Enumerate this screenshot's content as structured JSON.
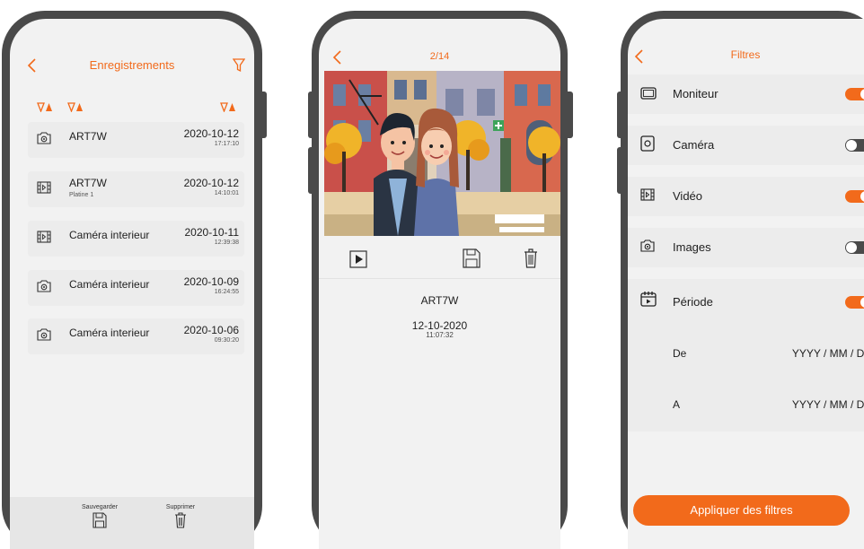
{
  "colors": {
    "accent": "#f26a1b",
    "frame": "#4a4a4a",
    "screen": "#f2f2f2"
  },
  "recordings": {
    "title": "Enregistrements",
    "items": [
      {
        "type": "camera-icon",
        "name": "ART7W",
        "sub": "",
        "date": "2020-10-12",
        "time": "17:17:10"
      },
      {
        "type": "video-icon",
        "name": "ART7W",
        "sub": "Platine 1",
        "date": "2020-10-12",
        "time": "14:10:01"
      },
      {
        "type": "video-icon",
        "name": "Caméra interieur",
        "sub": "",
        "date": "2020-10-11",
        "time": "12:39:38"
      },
      {
        "type": "camera-icon",
        "name": "Caméra interieur",
        "sub": "",
        "date": "2020-10-09",
        "time": "16:24:55"
      },
      {
        "type": "camera-icon",
        "name": "Caméra interieur",
        "sub": "",
        "date": "2020-10-06",
        "time": "09:30:20"
      }
    ],
    "save_label": "Sauvegarder",
    "delete_label": "Supprimer"
  },
  "viewer": {
    "counter": "2/14",
    "name": "ART7W",
    "date": "12-10-2020",
    "time": "11:07:32"
  },
  "filters": {
    "title": "Filtres",
    "options": [
      {
        "label": "Moniteur",
        "icon": "monitor-icon",
        "enabled": true
      },
      {
        "label": "Caméra",
        "icon": "camera-icon",
        "enabled": false
      },
      {
        "label": "Vidéo",
        "icon": "video-icon",
        "enabled": true
      },
      {
        "label": "Images",
        "icon": "image-icon",
        "enabled": false
      },
      {
        "label": "Période",
        "icon": "calendar-icon",
        "enabled": true
      }
    ],
    "from_label": "De",
    "from_value": "YYYY / MM / DD",
    "to_label": "A",
    "to_value": "YYYY / MM / DD",
    "apply_label": "Appliquer des filtres"
  }
}
